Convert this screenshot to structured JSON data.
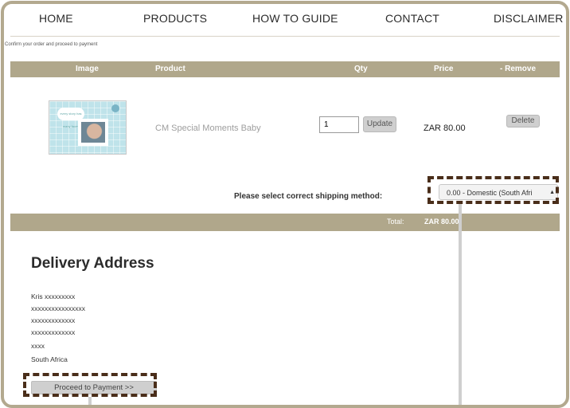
{
  "nav": {
    "items": [
      "HOME",
      "PRODUCTS",
      "HOW TO GUIDE",
      "CONTACT",
      "DISCLAIMER"
    ]
  },
  "breadcrumb": "Confirm your order and proceed to payment",
  "table": {
    "headers": {
      "image": "Image",
      "product": "Product",
      "qty": "Qty",
      "price": "Price",
      "remove": "- Remove"
    },
    "row": {
      "thumb_text": "every story has many faces",
      "product": "CM Special Moments Baby",
      "qty": "1",
      "update": "Update",
      "price": "ZAR 80.00",
      "delete": "Delete"
    }
  },
  "shipping": {
    "label": "Please select correct shipping method:",
    "selected": "0.00 - Domestic (South Afri"
  },
  "total": {
    "label": "Total:",
    "value": "ZAR 80.00"
  },
  "delivery": {
    "title": "Delivery Address",
    "lines": [
      "Kris xxxxxxxxx",
      "xxxxxxxxxxxxxxxx",
      "xxxxxxxxxxxxx",
      "xxxxxxxxxxxxx",
      "xxxx",
      "South Africa"
    ]
  },
  "proceed_button": "Proceed to Payment >>",
  "colors": {
    "frame": "#b3a98f",
    "header_bar": "#b0a78b",
    "highlight_dash": "#4a2e1a"
  }
}
